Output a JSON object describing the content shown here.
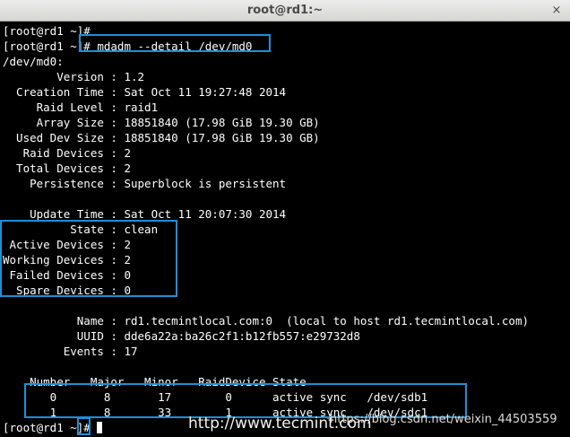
{
  "window": {
    "title": "root@rd1:~",
    "close_label": "×"
  },
  "terminal": {
    "lines": [
      "[root@rd1 ~]#",
      "[root@rd1 ~]# mdadm --detail /dev/md0",
      "/dev/md0:",
      "        Version : 1.2",
      "  Creation Time : Sat Oct 11 19:27:48 2014",
      "     Raid Level : raid1",
      "     Array Size : 18851840 (17.98 GiB 19.30 GB)",
      "  Used Dev Size : 18851840 (17.98 GiB 19.30 GB)",
      "   Raid Devices : 2",
      "  Total Devices : 2",
      "    Persistence : Superblock is persistent",
      "",
      "    Update Time : Sat Oct 11 20:07:30 2014",
      "          State : clean",
      " Active Devices : 2",
      "Working Devices : 2",
      " Failed Devices : 0",
      "  Spare Devices : 0",
      "",
      "           Name : rd1.tecmintlocal.com:0  (local to host rd1.tecmintlocal.com)",
      "           UUID : dde6a22a:ba26c2f1:b12fb557:e29732d8",
      "         Events : 17",
      "",
      "    Number   Major   Minor   RaidDevice State",
      "       0       8       17        0      active sync   /dev/sdb1",
      "       1       8       33        1      active sync   /dev/sdc1"
    ],
    "last_prompt": "[root@rd1 ~]# "
  },
  "watermarks": {
    "primary": "http://www.tecmint.com",
    "secondary": "https://blog.csdn.net/weixin_44503559"
  },
  "highlight_color": "#1e8fd6"
}
